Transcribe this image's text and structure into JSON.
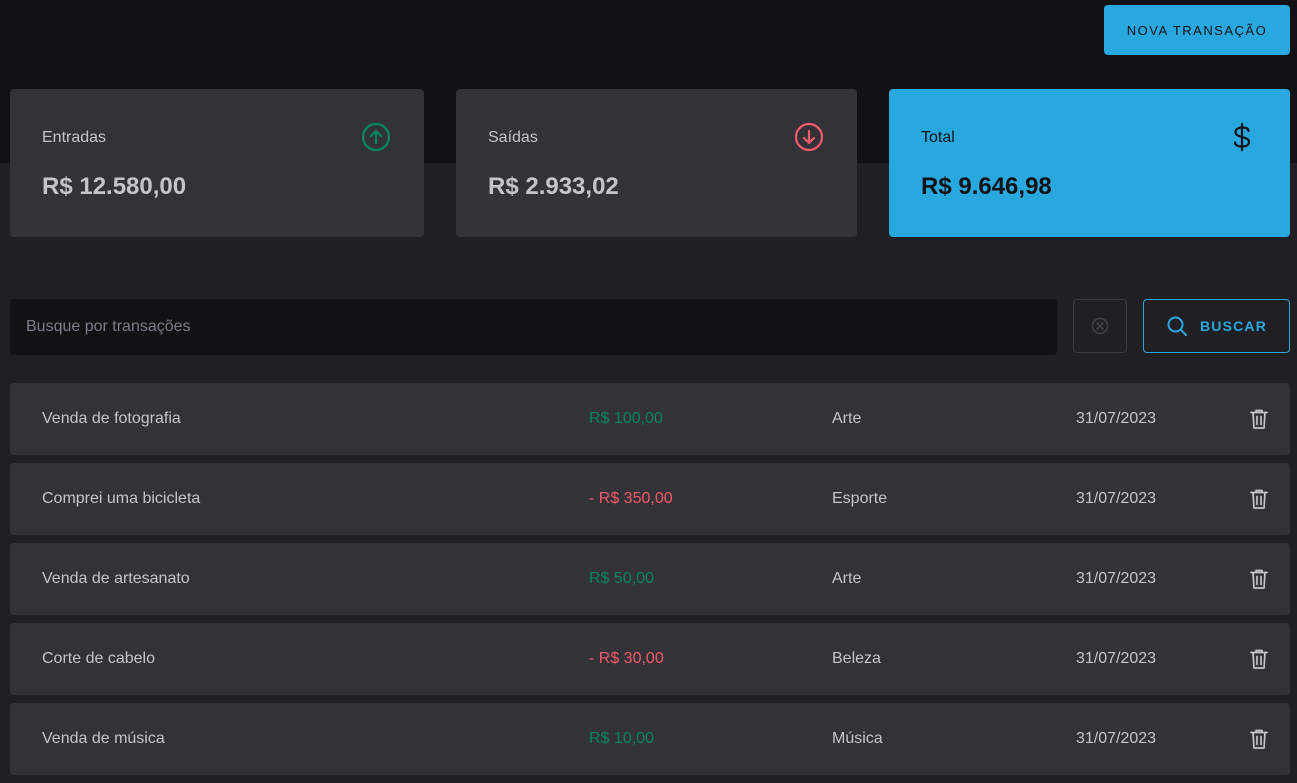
{
  "header": {
    "new_transaction_label": "NOVA TRANSAÇÃO"
  },
  "summary": {
    "income": {
      "label": "Entradas",
      "value": "R$ 12.580,00",
      "icon": "arrow-circle-up-icon",
      "color": "#00875f"
    },
    "outcome": {
      "label": "Saídas",
      "value": "R$ 2.933,02",
      "icon": "arrow-circle-down-icon",
      "color": "#f75a68"
    },
    "total": {
      "label": "Total",
      "value": "R$ 9.646,98",
      "icon": "dollar-icon",
      "color": "#29a8e0"
    }
  },
  "search": {
    "placeholder": "Busque por transações",
    "value": "",
    "button_label": "BUSCAR"
  },
  "transactions": [
    {
      "description": "Venda de fotografia",
      "price": "R$ 100,00",
      "type": "income",
      "category": "Arte",
      "date": "31/07/2023"
    },
    {
      "description": "Comprei uma bicicleta",
      "price": "- R$ 350,00",
      "type": "outcome",
      "category": "Esporte",
      "date": "31/07/2023"
    },
    {
      "description": "Venda de artesanato",
      "price": "R$ 50,00",
      "type": "income",
      "category": "Arte",
      "date": "31/07/2023"
    },
    {
      "description": "Corte de cabelo",
      "price": "- R$ 30,00",
      "type": "outcome",
      "category": "Beleza",
      "date": "31/07/2023"
    },
    {
      "description": "Venda de música",
      "price": "R$ 10,00",
      "type": "income",
      "category": "Música",
      "date": "31/07/2023"
    }
  ],
  "colors": {
    "background": "#202024",
    "header": "#121214",
    "card": "#323238",
    "accent": "#29a8e0",
    "income": "#00875f",
    "outcome": "#f75a68"
  }
}
